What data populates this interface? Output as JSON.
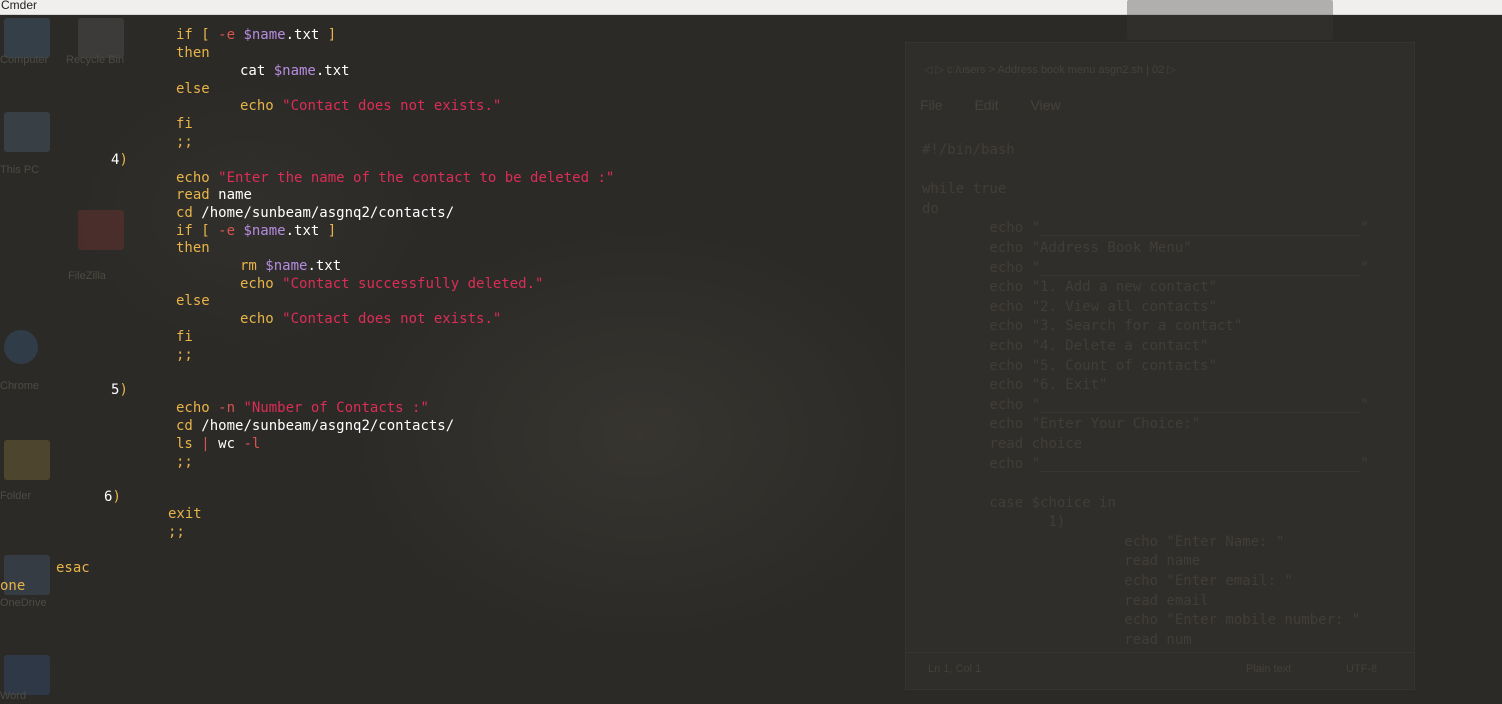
{
  "window": {
    "title": "Cmder"
  },
  "terminal": {
    "lines": [
      {
        "tokens": [
          [
            "kw",
            "if [ "
          ],
          [
            "op",
            "-e "
          ],
          [
            "var",
            "$name"
          ],
          [
            "txt",
            ".txt "
          ],
          [
            "kw",
            "]"
          ]
        ]
      },
      {
        "tokens": [
          [
            "kw",
            "then"
          ]
        ]
      },
      {
        "tokens": [
          [
            "txt",
            "cat "
          ],
          [
            "var",
            "$name"
          ],
          [
            "txt",
            ".txt"
          ]
        ]
      },
      {
        "tokens": [
          [
            "kw",
            "else"
          ]
        ]
      },
      {
        "tokens": [
          [
            "kw",
            "echo "
          ],
          [
            "str",
            "\"Contact does not exists.\""
          ]
        ]
      },
      {
        "tokens": [
          [
            "kw",
            "fi"
          ]
        ]
      },
      {
        "tokens": [
          [
            "kw",
            ";;"
          ]
        ]
      },
      {
        "tokens": [
          [
            "txt",
            "4"
          ],
          [
            "kw",
            ")"
          ]
        ]
      },
      {
        "tokens": [
          [
            "kw",
            "echo "
          ],
          [
            "str",
            "\"Enter the name of the contact to be deleted :\""
          ]
        ]
      },
      {
        "tokens": [
          [
            "kw",
            "read "
          ],
          [
            "txt",
            "name"
          ]
        ]
      },
      {
        "tokens": [
          [
            "kw",
            "cd "
          ],
          [
            "txt",
            "/home/sunbeam/asgnq2/contacts/"
          ]
        ]
      },
      {
        "tokens": [
          [
            "kw",
            "if [ "
          ],
          [
            "op",
            "-e "
          ],
          [
            "var",
            "$name"
          ],
          [
            "txt",
            ".txt "
          ],
          [
            "kw",
            "]"
          ]
        ]
      },
      {
        "tokens": [
          [
            "kw",
            "then"
          ]
        ]
      },
      {
        "tokens": [
          [
            "kw",
            "rm "
          ],
          [
            "var",
            "$name"
          ],
          [
            "txt",
            ".txt"
          ]
        ]
      },
      {
        "tokens": [
          [
            "kw",
            "echo "
          ],
          [
            "str",
            "\"Contact successfully deleted.\""
          ]
        ]
      },
      {
        "tokens": [
          [
            "kw",
            "else"
          ]
        ]
      },
      {
        "tokens": [
          [
            "kw",
            "echo "
          ],
          [
            "str",
            "\"Contact does not exists.\""
          ]
        ]
      },
      {
        "tokens": [
          [
            "kw",
            "fi"
          ]
        ]
      },
      {
        "tokens": [
          [
            "kw",
            ";;"
          ]
        ]
      },
      {
        "tokens": [
          [
            "txt",
            "5"
          ],
          [
            "kw",
            ")"
          ]
        ]
      },
      {
        "tokens": [
          [
            "kw",
            "echo "
          ],
          [
            "op",
            "-n "
          ],
          [
            "str",
            "\"Number of Contacts :\""
          ]
        ]
      },
      {
        "tokens": [
          [
            "kw",
            "cd "
          ],
          [
            "txt",
            "/home/sunbeam/asgnq2/contacts/"
          ]
        ]
      },
      {
        "tokens": [
          [
            "kw",
            "ls "
          ],
          [
            "op",
            "| "
          ],
          [
            "txt",
            "wc "
          ],
          [
            "op",
            "-l"
          ]
        ]
      },
      {
        "tokens": [
          [
            "kw",
            ";;"
          ]
        ]
      },
      {
        "tokens": [
          [
            "txt",
            "6"
          ],
          [
            "kw",
            ")"
          ]
        ]
      },
      {
        "tokens": [
          [
            "kw",
            "exit"
          ]
        ]
      },
      {
        "tokens": [
          [
            "kw",
            ";;"
          ]
        ]
      },
      {
        "tokens": [
          [
            "kw",
            "esac"
          ]
        ]
      },
      {
        "tokens": [
          [
            "kw",
            "one"
          ]
        ]
      }
    ]
  },
  "background_editor": {
    "topbar": "◁  ▷   c:/users   >   Address book menu        asgn2.sh   |  02   ▷",
    "menu": [
      "File",
      "Edit",
      "View"
    ],
    "code": "#!/bin/bash\n\nwhile true\ndo\n        echo \"______________________________________\"\n        echo \"Address Book Menu\"\n        echo \"______________________________________\"\n        echo \"1. Add a new contact\"\n        echo \"2. View all contacts\"\n        echo \"3. Search for a contact\"\n        echo \"4. Delete a contact\"\n        echo \"5. Count of contacts\"\n        echo \"6. Exit\"\n        echo \"______________________________________\"\n        echo \"Enter Your Choice:\"\n        read choice\n        echo \"______________________________________\"\n\n        case $choice in\n               1)\n                        echo \"Enter Name: \"\n                        read name\n                        echo \"Enter email: \"\n                        read email\n                        echo \"Enter mobile number: \"\n                        read num",
    "status_left": "Ln 1, Col 1",
    "status_mid": "Plain text",
    "status_right": "UTF-8"
  },
  "desktop_icons": [
    {
      "label": "Computer"
    },
    {
      "label": "Recycle Bin"
    },
    {
      "label": "This PC"
    },
    {
      "label": "FileZilla"
    },
    {
      "label": "Chrome"
    },
    {
      "label": "Folder"
    },
    {
      "label": "OneDrive"
    },
    {
      "label": "Word"
    }
  ],
  "colors": {
    "keyword": "#e8b449",
    "string": "#dc2d55",
    "variable": "#b68ce0",
    "operator": "#d9534f",
    "text": "#ffffff"
  }
}
